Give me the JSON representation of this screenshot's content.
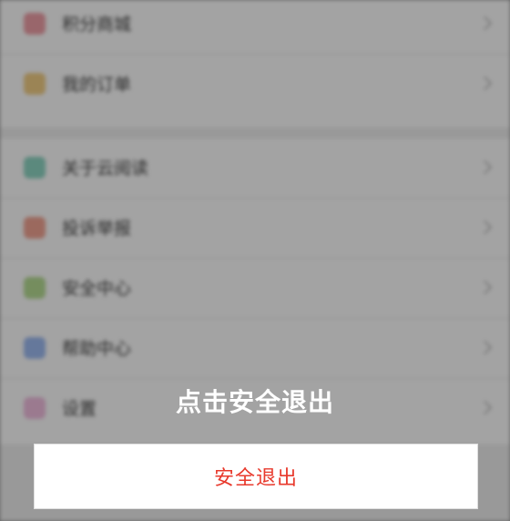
{
  "background": {
    "group_a": [
      {
        "label": "积分商城",
        "icon": "gift-icon",
        "color": "#f0a0a8"
      },
      {
        "label": "我的订单",
        "icon": "order-icon",
        "color": "#f3cf86"
      }
    ],
    "group_b": [
      {
        "label": "关于云阅读",
        "icon": "info-icon",
        "color": "#8fd6c4"
      },
      {
        "label": "投诉举报",
        "icon": "report-icon",
        "color": "#f3a594"
      },
      {
        "label": "安全中心",
        "icon": "shield-icon",
        "color": "#b7dd94"
      },
      {
        "label": "帮助中心",
        "icon": "help-icon",
        "color": "#9fbcf2"
      },
      {
        "label": "设置",
        "icon": "gear-icon",
        "color": "#f2bfe0"
      }
    ]
  },
  "dialog": {
    "title": "点击安全退出",
    "action_label": "安全退出",
    "action_color": "#e8392c"
  }
}
